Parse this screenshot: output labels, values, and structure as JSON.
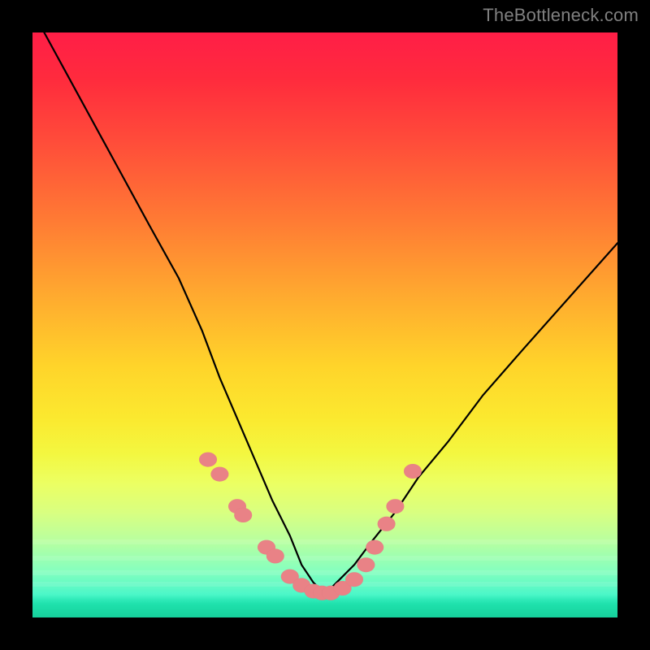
{
  "watermark": "TheBottleneck.com",
  "chart_data": {
    "type": "line",
    "title": "",
    "xlabel": "",
    "ylabel": "",
    "xlim": [
      0,
      100
    ],
    "ylim": [
      0,
      100
    ],
    "grid": false,
    "legend": false,
    "series": [
      {
        "name": "bottleneck-curve",
        "x": [
          2,
          8,
          14,
          20,
          25,
          29,
          32,
          35,
          38,
          41,
          44,
          46,
          48,
          50,
          52,
          55,
          58,
          62,
          66,
          71,
          77,
          84,
          92,
          100
        ],
        "values": [
          100,
          89,
          78,
          67,
          58,
          49,
          41,
          34,
          27,
          20,
          14,
          9,
          6,
          4,
          6,
          9,
          13,
          18,
          24,
          30,
          38,
          46,
          55,
          64
        ]
      }
    ],
    "markers": {
      "name": "sample-points",
      "x": [
        30,
        32,
        35,
        36,
        40,
        41.5,
        44,
        46,
        48,
        49.5,
        51,
        53,
        55,
        57,
        58.5,
        60.5,
        62,
        65
      ],
      "y": [
        27,
        24.5,
        19,
        17.5,
        12,
        10.5,
        7,
        5.5,
        4.5,
        4.2,
        4.2,
        5,
        6.5,
        9,
        12,
        16,
        19,
        25
      ]
    },
    "background_gradient": [
      "#ff1e47",
      "#ff7a34",
      "#ffd42a",
      "#ecff62",
      "#4cf7c8",
      "#16d09c"
    ]
  }
}
